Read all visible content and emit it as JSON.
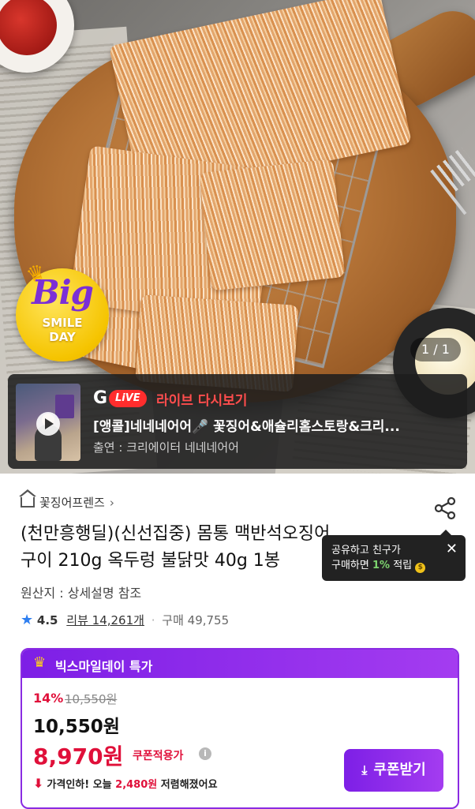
{
  "hero": {
    "badge": {
      "big": "Big",
      "smile": "SMILE",
      "day": "DAY"
    },
    "page_counter": "1 / 1"
  },
  "live": {
    "logo": "G",
    "live_pill": "LiVE",
    "title": "라이브 다시보기",
    "description": "[앵콜]네네네어어🎤 꽃징어&애슐리홈스토랑&크리...",
    "cast": "출연 : 크리에이터 네네네어어"
  },
  "product": {
    "brand": "꽃징어프렌즈",
    "title_line1": "(천만흥행딜)(신선집중) 몸통 맥반석오징어",
    "title_line2": "구이 210g 옥두렁 불닭맛 40g 1봉",
    "origin": "원산지 : 상세설명 참조",
    "rating": "4.5",
    "reviews": "리뷰 14,261개",
    "purchases": "구매 49,755"
  },
  "tooltip": {
    "line1": "공유하고 친구가",
    "line2_prefix": "구매하면 ",
    "line2_pct": "1%",
    "line2_suffix": " 적립"
  },
  "deal": {
    "header": "빅스마일데이 특가",
    "discount_pct": "14%",
    "original_price": "10,550원",
    "sale_price": "10,550원",
    "coupon_price": "8,970원",
    "coupon_note": "쿠폰적용가",
    "drop_prefix": "가격인하! 오늘 ",
    "drop_amount": "2,480원",
    "drop_suffix": " 저렴해졌어요",
    "coupon_button": "쿠폰받기"
  },
  "colors": {
    "accent_purple": "#8a2be2",
    "price_red": "#e0103a",
    "live_red": "#ff2d2d"
  }
}
